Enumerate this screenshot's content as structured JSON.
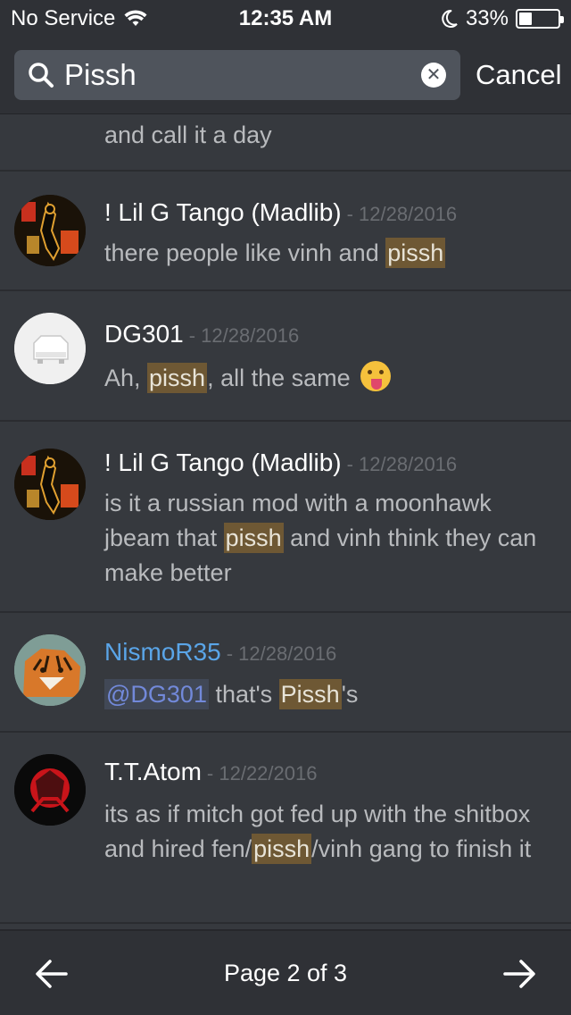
{
  "status": {
    "carrier": "No Service",
    "time": "12:35 AM",
    "battery_percent": "33%",
    "battery_level": 0.33
  },
  "search": {
    "query": "Pissh",
    "cancel_label": "Cancel"
  },
  "results": [
    {
      "text_parts": [
        {
          "t": "and call it a day"
        }
      ]
    },
    {
      "author": "! Lil G Tango (Madlib)",
      "author_color": "#ffffff",
      "date": "- 12/28/2016",
      "text_parts": [
        {
          "t": "there people like vinh and "
        },
        {
          "t": "pissh",
          "hl": true
        }
      ]
    },
    {
      "author": "DG301",
      "author_color": "#ffffff",
      "date": "- 12/28/2016",
      "text_parts": [
        {
          "t": "Ah, "
        },
        {
          "t": "pissh",
          "hl": true
        },
        {
          "t": ", all the same "
        }
      ],
      "emoji": "tongue-out-emoji"
    },
    {
      "author": "! Lil G Tango (Madlib)",
      "author_color": "#ffffff",
      "date": "- 12/28/2016",
      "text_parts": [
        {
          "t": "is it a russian mod with a moonhawk jbeam that "
        },
        {
          "t": "pissh",
          "hl": true
        },
        {
          "t": " and vinh think they can make better"
        }
      ]
    },
    {
      "author": "NismoR35",
      "author_color": "#5aa5e8",
      "date": "- 12/28/2016",
      "text_parts": [
        {
          "t": "@DG301",
          "mention": true
        },
        {
          "t": " that's "
        },
        {
          "t": "Pissh",
          "hl": true
        },
        {
          "t": "'s"
        }
      ]
    },
    {
      "author": "T.T.Atom",
      "author_color": "#ffffff",
      "date": "- 12/22/2016",
      "text_parts": [
        {
          "t": "its as if mitch got fed up with the shitbox and hired fen/"
        },
        {
          "t": "pissh",
          "hl": true
        },
        {
          "t": "/vinh gang to finish it"
        }
      ]
    }
  ],
  "pagination": {
    "label": "Page 2 of 3"
  },
  "colors": {
    "background": "#36393e",
    "header": "#2f3136",
    "highlight": "#6e5834",
    "mention": "#7289da"
  }
}
